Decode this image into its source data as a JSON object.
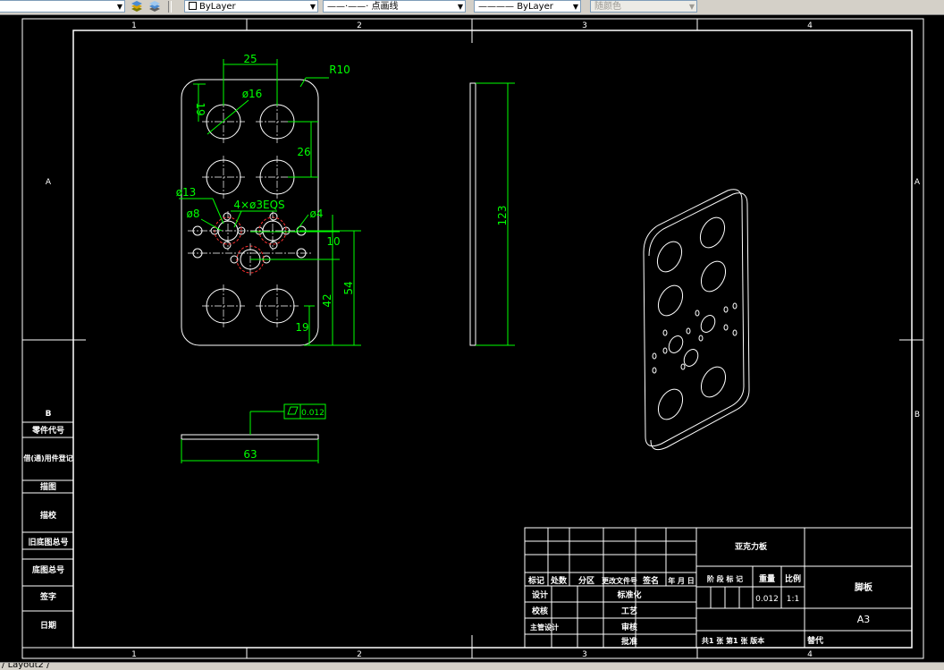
{
  "toolbar": {
    "layer_value": "ByLayer",
    "linetype_value": "点画线",
    "lineweight_value": "ByLayer",
    "plotstyle_value": "随颜色",
    "icons": [
      "layer-states-icon",
      "layer-previous-icon"
    ]
  },
  "frame": {
    "zone_cols": [
      "1",
      "2",
      "3",
      "4"
    ],
    "zone_rows_left": [
      "A",
      "B"
    ],
    "zone_rows_right": [
      "A",
      "B"
    ]
  },
  "left_table": {
    "title": "B",
    "rows": [
      "零件代号",
      "借(通)用件登记",
      "描图",
      "描校",
      "旧底图总号",
      "底图总号",
      "签字",
      "日期"
    ]
  },
  "dimensions": {
    "d25": "25",
    "r10": "R10",
    "d16": "ø16",
    "d19_top": "19",
    "d26": "26",
    "d13": "ø13",
    "holes": "4×ø3EQS",
    "d8": "ø8",
    "d4": "ø4",
    "d10": "10",
    "d42": "42",
    "d54": "54",
    "d19_bottom": "19",
    "d123": "123",
    "d63": "63",
    "flatness_tol": "0.012"
  },
  "title_block": {
    "org_label": "亚克力板",
    "part_name": "脚板",
    "sheet_size": "A3",
    "header_cells": [
      "标记",
      "处数",
      "分区",
      "更改文件号",
      "签名",
      "年 月 日"
    ],
    "role_labels": [
      "设计",
      "校核",
      "主管设计"
    ],
    "mid_labels": [
      "标准化",
      "工艺",
      "审核",
      "批准"
    ],
    "stage_label": "阶 段 标 记",
    "weight_label": "重量",
    "scale_label": "比例",
    "weight_value": "0.012",
    "scale_value": "1:1",
    "sheet_info": "共1 张  第1 张  版本",
    "replace_label": "替代"
  },
  "status": {
    "layout_tab": "Layout2"
  },
  "colors": {
    "background": "#000000",
    "lines": "#ffffff",
    "dimensions": "#00ff00",
    "hidden_circles": "#ff3030"
  }
}
